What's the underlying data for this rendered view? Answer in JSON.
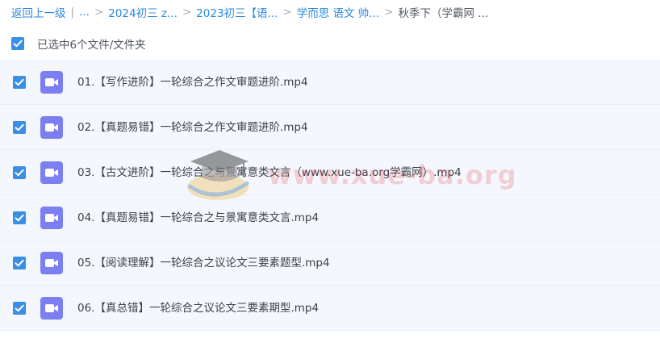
{
  "breadcrumb": {
    "back_label": "返回上一级",
    "separator": "|",
    "ellipsis": "...",
    "arrow": ">",
    "path": [
      "2024初三 z...",
      "2023初三【语...",
      "学而思 语文 帅...",
      "秋季下（学霸网 ..."
    ]
  },
  "selection": {
    "label": "已选中6个文件/文件夹",
    "all_checked": true
  },
  "files": [
    {
      "name": "01.【写作进阶】一轮综合之作文审题进阶.mp4",
      "checked": true,
      "icon": "video-icon"
    },
    {
      "name": "02.【真题易错】一轮综合之作文审题进阶.mp4",
      "checked": true,
      "icon": "video-icon"
    },
    {
      "name": "03.【古文进阶】一轮综合之与景寓意类文言（www.xue-ba.org学霸网）.mp4",
      "checked": true,
      "icon": "video-icon"
    },
    {
      "name": "04.【真题易错】一轮综合之与景寓意类文言.mp4",
      "checked": true,
      "icon": "video-icon"
    },
    {
      "name": "05.【阅读理解】一轮综合之议论文三要素题型.mp4",
      "checked": true,
      "icon": "video-icon"
    },
    {
      "name": "06.【真总错】一轮综合之议论文三要素期型.mp4",
      "checked": true,
      "icon": "video-icon"
    }
  ],
  "watermark": {
    "text": "www.xue-ba.org",
    "logo": "graduation-cap-logo"
  },
  "colors": {
    "accent": "#2c8ae0",
    "video_icon": "#7b7ff2",
    "row_bg": "#f4f8fe"
  }
}
